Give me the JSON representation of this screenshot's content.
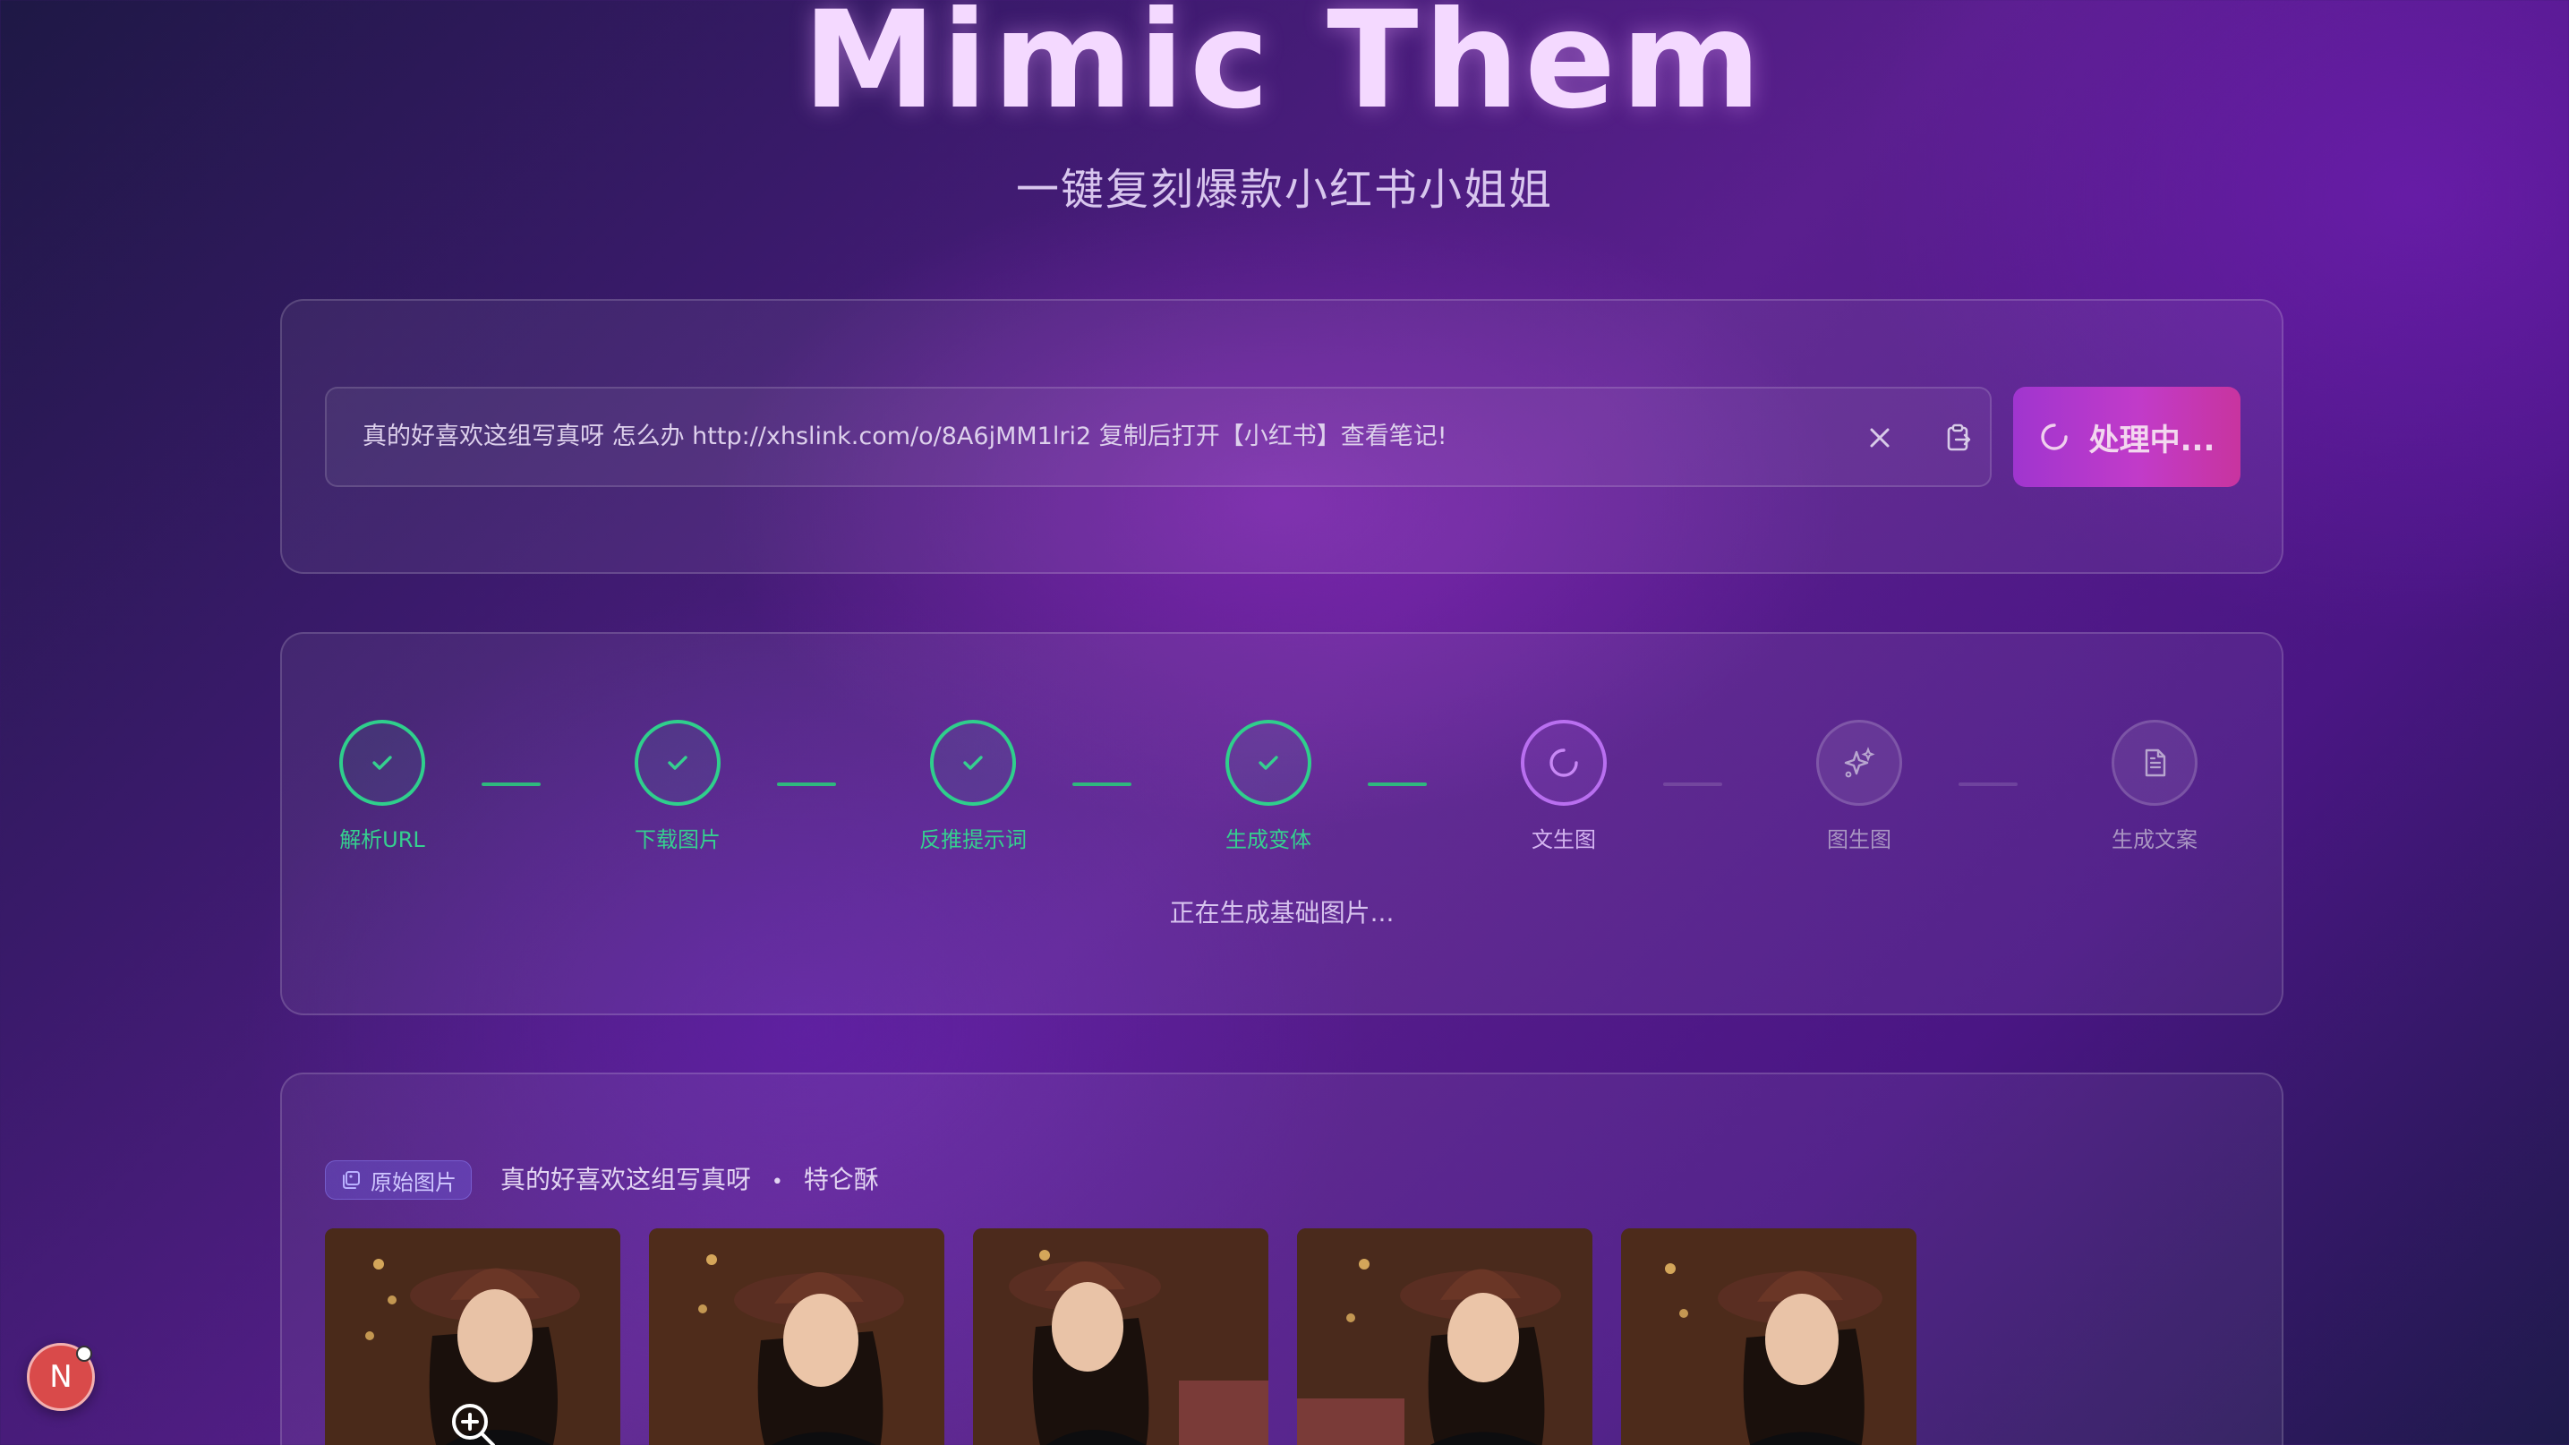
{
  "header": {
    "title": "Mimic Them",
    "subtitle": "一键复刻爆款小红书小姐姐"
  },
  "input": {
    "value": "真的好喜欢这组写真呀 怎么办 http://xhslink.com/o/8A6jMM1lri2 复制后打开【小红书】查看笔记!",
    "clear_icon": "close-icon",
    "paste_icon": "clipboard-paste-icon"
  },
  "process_button": {
    "label": "处理中...",
    "icon": "spinner-icon"
  },
  "steps": [
    {
      "label": "解析URL",
      "state": "done"
    },
    {
      "label": "下载图片",
      "state": "done"
    },
    {
      "label": "反推提示词",
      "state": "done"
    },
    {
      "label": "生成变体",
      "state": "done"
    },
    {
      "label": "文生图",
      "state": "active"
    },
    {
      "label": "图生图",
      "state": "pending"
    },
    {
      "label": "生成文案",
      "state": "pending"
    }
  ],
  "status_text": "正在生成基础图片...",
  "images_section": {
    "badge_label": "原始图片",
    "post_title": "真的好喜欢这组写真呀",
    "separator": "•",
    "author": "特仑酥",
    "image_count": 5
  },
  "avatar": {
    "letter": "N"
  },
  "colors": {
    "done": "#2fcf8c",
    "active": "#b96ff0",
    "button_start": "#a035cf",
    "button_end": "#c8349f",
    "title": "#f4d9ff"
  }
}
